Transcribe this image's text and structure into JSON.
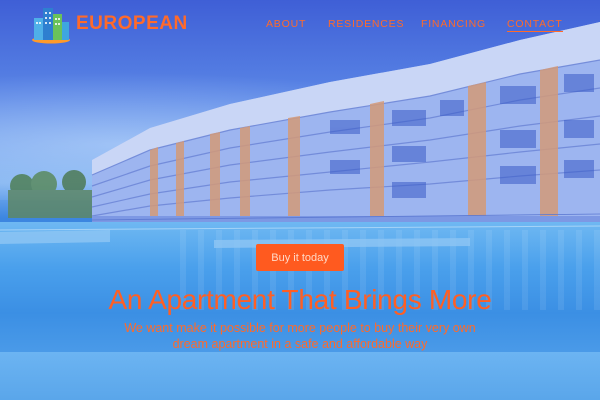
{
  "brand": {
    "name": "EUROPEAN",
    "logo_icon": "apartment-tower-logo"
  },
  "nav": {
    "items": [
      {
        "label": "ABOUT"
      },
      {
        "label": "RESIDENCES"
      },
      {
        "label": "FINANCING"
      },
      {
        "label": "CONTACT",
        "active": true
      }
    ]
  },
  "hero": {
    "cta_label": "Buy it today",
    "headline": "An Apartment That Brings More",
    "subline": "We want make it possible for more people to buy their very own dream apartment in a safe and affordable way"
  },
  "colors": {
    "accent": "#ff5f24",
    "overlay": "#3f6fe0"
  }
}
